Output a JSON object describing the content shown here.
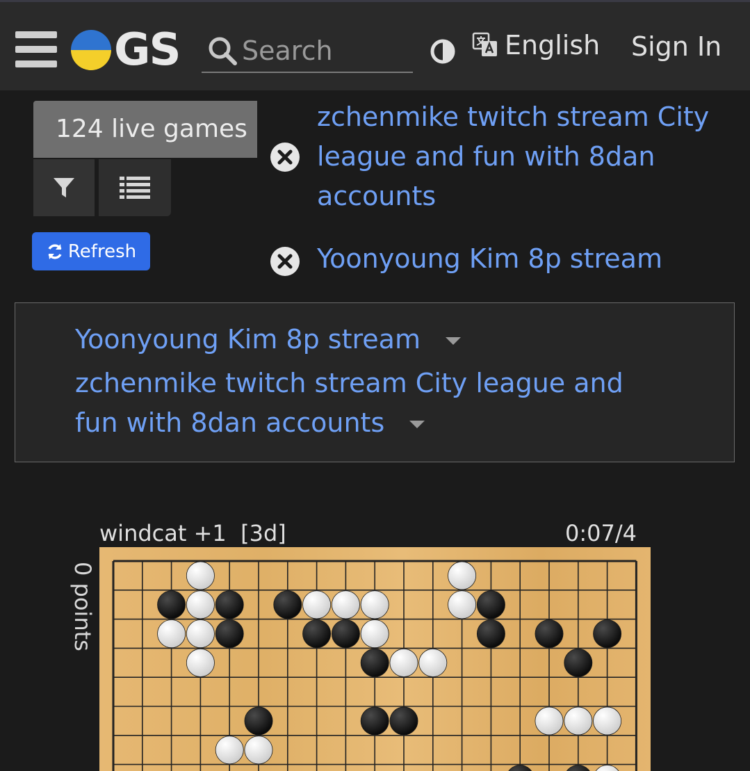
{
  "header": {
    "logo_text": "GS",
    "search_placeholder": "Search",
    "language": "English",
    "sign_in": "Sign In",
    "icons": [
      "hamburger-menu-icon",
      "search-icon",
      "theme-toggle-icon",
      "translate-icon"
    ]
  },
  "controls": {
    "live_games": "124 live games",
    "refresh": "Refresh",
    "refresh_color": "#2f6be6"
  },
  "streams": [
    {
      "title": "zchenmike twitch stream City league and fun with 8dan accounts"
    },
    {
      "title": "Yoonyoung Kim 8p stream"
    }
  ],
  "stream_panel": [
    {
      "title": "Yoonyoung Kim 8p stream"
    },
    {
      "title": "zchenmike twitch stream City league and fun with 8dan accounts"
    }
  ],
  "game": {
    "player_label": "windcat +1  [3d]",
    "clock": "0:07/4",
    "points": "0 points",
    "stones": {
      "white": [
        [
          3,
          0
        ],
        [
          12,
          0
        ],
        [
          3,
          1
        ],
        [
          7,
          1
        ],
        [
          8,
          1
        ],
        [
          9,
          1
        ],
        [
          12,
          1
        ],
        [
          2,
          2
        ],
        [
          3,
          2
        ],
        [
          9,
          2
        ],
        [
          3,
          3
        ],
        [
          10,
          3
        ],
        [
          11,
          3
        ],
        [
          15,
          5
        ],
        [
          16,
          5
        ],
        [
          17,
          5
        ],
        [
          4,
          6
        ],
        [
          5,
          6
        ],
        [
          17,
          7
        ]
      ],
      "black": [
        [
          2,
          1
        ],
        [
          4,
          1
        ],
        [
          6,
          1
        ],
        [
          13,
          1
        ],
        [
          4,
          2
        ],
        [
          7,
          2
        ],
        [
          8,
          2
        ],
        [
          13,
          2
        ],
        [
          15,
          2
        ],
        [
          17,
          2
        ],
        [
          9,
          3
        ],
        [
          16,
          3
        ],
        [
          5,
          5
        ],
        [
          9,
          5
        ],
        [
          10,
          5
        ],
        [
          14,
          7
        ],
        [
          16,
          7
        ]
      ]
    }
  },
  "colors": {
    "link": "#6fa0f5",
    "board": "#e2b36d",
    "background": "#1b1b1b",
    "header": "#2a2a2a"
  }
}
